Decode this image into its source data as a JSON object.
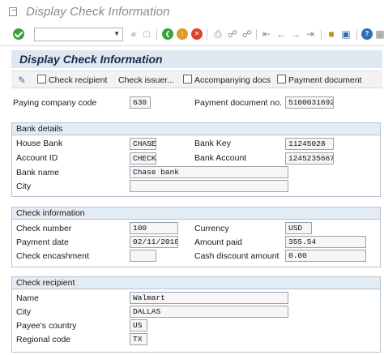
{
  "window": {
    "title": "Display Check Information"
  },
  "toolbar": {
    "command_value": "",
    "icons": [
      "enter-icon",
      "save-icon",
      "back-icon",
      "exit-icon",
      "cancel-icon",
      "print-icon",
      "find-icon",
      "find-next-icon",
      "first-page-icon",
      "prev-page-icon",
      "next-page-icon",
      "last-page-icon",
      "create-session-icon",
      "shortcut-icon",
      "help-icon",
      "layout-icon"
    ]
  },
  "screen": {
    "title": "Display Check Information"
  },
  "app_toolbar": {
    "check_recipient": "Check recipient",
    "check_issuer": "Check issuer...",
    "accompanying_docs": "Accompanying docs",
    "payment_document": "Payment document"
  },
  "header": {
    "paying_company_code_label": "Paying company code",
    "paying_company_code": "630",
    "payment_document_no_label": "Payment document no.",
    "payment_document_no": "5100031692"
  },
  "bank_details": {
    "title": "Bank details",
    "house_bank_label": "House Bank",
    "house_bank": "CHASE",
    "bank_key_label": "Bank Key",
    "bank_key": "11245028",
    "account_id_label": "Account ID",
    "account_id": "CHECK",
    "bank_account_label": "Bank Account",
    "bank_account": "1245235667",
    "bank_name_label": "Bank name",
    "bank_name": "Chase bank",
    "city_label": "City",
    "city": ""
  },
  "check_information": {
    "title": "Check information",
    "check_number_label": "Check number",
    "check_number": "100",
    "currency_label": "Currency",
    "currency": "USD",
    "payment_date_label": "Payment date",
    "payment_date": "02/11/2018",
    "amount_paid_label": "Amount paid",
    "amount_paid": "355.54",
    "check_encashment_label": "Check encashment",
    "check_encashment": "",
    "cash_discount_label": "Cash discount amount",
    "cash_discount": "0.00"
  },
  "check_recipient": {
    "title": "Check recipient",
    "name_label": "Name",
    "name": "Walmart",
    "city_label": "City",
    "city": "DALLAS",
    "country_label": "Payee's country",
    "country": "US",
    "region_label": "Regional code",
    "region": "TX"
  }
}
